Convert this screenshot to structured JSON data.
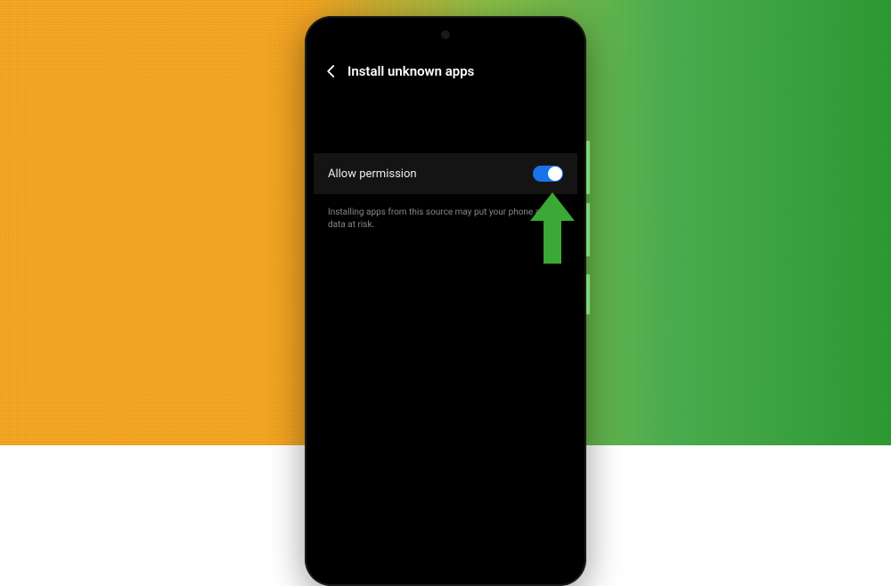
{
  "header": {
    "title": "Install unknown apps"
  },
  "setting": {
    "label": "Allow permission",
    "toggle_on": true
  },
  "description": "Installing apps from this source may put your phone and data at risk.",
  "annotation": {
    "arrow_color": "#3ba935"
  }
}
